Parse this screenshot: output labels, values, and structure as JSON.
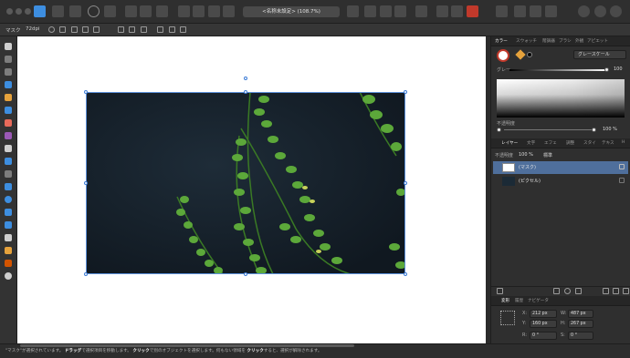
{
  "document": {
    "title": "<名称未設定> (108.7%)"
  },
  "context_bar": {
    "mode": "マスク",
    "dpi": "72dpi"
  },
  "canvas": {
    "selection_handles": 8
  },
  "status": {
    "part1": "\"マスク\"が選択されています。",
    "drag": "ドラッグ",
    "part2": "で選択項目を移動します。",
    "click": "クリック",
    "part3": "で別のオブジェクトを選択します。何もない領域を",
    "click2": "クリック",
    "part4": "すると、選択が解除されます。"
  },
  "color_panel": {
    "tabs": [
      "カラー",
      "スウォッチ",
      "階調器",
      "ブラシ",
      "外観",
      "アピエット"
    ],
    "active_tab": 0,
    "mode_label": "グレースケール",
    "slider_label": "グレー",
    "slider_value": "100",
    "opacity_label": "不透明度",
    "opacity_value": "100 %"
  },
  "layers_panel": {
    "tabs": [
      "レイヤー",
      "文字",
      "エフェ",
      "調整",
      "スタイ",
      "テキス",
      "H"
    ],
    "active_tab": 0,
    "opacity_label": "不透明度",
    "opacity_value": "100 %",
    "blend_mode": "標準",
    "layers": [
      {
        "name": "(マスク)",
        "selected": true
      },
      {
        "name": "(ピクセル)",
        "selected": false
      }
    ]
  },
  "transform_panel": {
    "tabs": [
      "変形",
      "履歴",
      "ナビゲータ"
    ],
    "active_tab": 0,
    "x_label": "X:",
    "x_value": "212 px",
    "y_label": "Y:",
    "y_value": "160 px",
    "w_label": "W:",
    "w_value": "487 px",
    "h_label": "H:",
    "h_value": "267 px",
    "r_label": "R:",
    "r_value": "0 °",
    "s_label": "S:",
    "s_value": "0 °"
  },
  "colors": {
    "accent": "#3d8ee0",
    "selection": "#4f6f9c",
    "leaf": "#5ca83a"
  }
}
